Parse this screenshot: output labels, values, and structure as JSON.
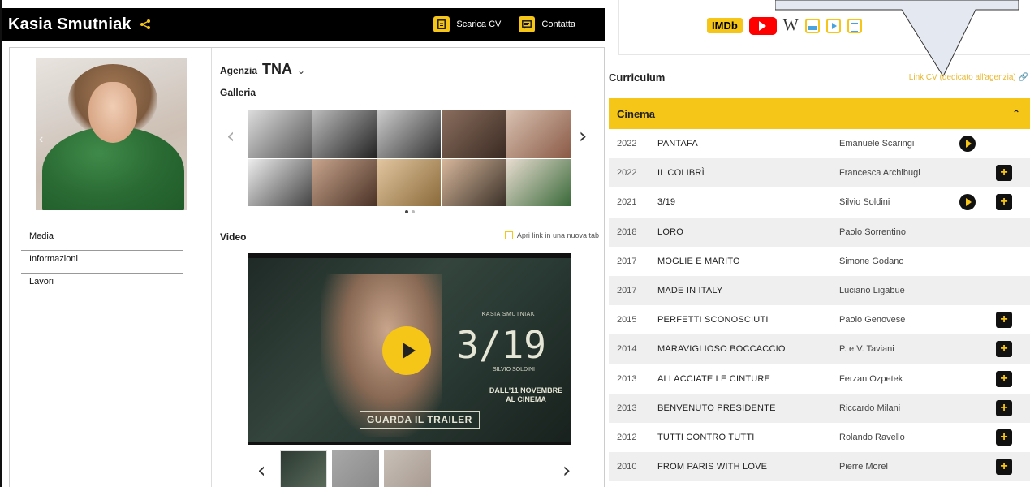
{
  "header": {
    "name": "Kasia Smutniak",
    "download_cv": "Scarica CV",
    "contact": "Contatta"
  },
  "side_menu": [
    {
      "label": "Media"
    },
    {
      "label": "Informazioni"
    },
    {
      "label": "Lavori"
    }
  ],
  "agency": {
    "label": "Agenzia",
    "value": "TNA"
  },
  "gallery": {
    "title": "Galleria",
    "photo_count": 10,
    "page_count": 2,
    "active_page": 1
  },
  "video": {
    "title": "Video",
    "open_new_tab": "Apri link in una nuova tab",
    "poster": {
      "name": "KASIA SMUTNIAK",
      "title": "3/19",
      "director": "SILVIO SOLDINI",
      "release": "DALL'11 NOVEMBRE AL CINEMA",
      "cta": "GUARDA IL TRAILER"
    },
    "thumb_count": 3
  },
  "links": {
    "imdb": "IMDb",
    "wiki": "W",
    "icons": [
      "imdb-icon",
      "youtube-icon",
      "wikipedia-icon",
      "image-icon",
      "video-icon",
      "news-icon"
    ]
  },
  "curriculum": {
    "title": "Curriculum",
    "agency_link": "Link CV (dedicato all'agenzia)",
    "section": "Cinema",
    "films": [
      {
        "year": "2022",
        "title": "PANTAFA",
        "director": "Emanuele Scaringi",
        "play": true,
        "plus": false
      },
      {
        "year": "2022",
        "title": "IL COLIBRÌ",
        "director": "Francesca Archibugi",
        "play": false,
        "plus": true
      },
      {
        "year": "2021",
        "title": "3/19",
        "director": "Silvio Soldini",
        "play": true,
        "plus": true
      },
      {
        "year": "2018",
        "title": "LORO",
        "director": "Paolo Sorrentino",
        "play": false,
        "plus": false
      },
      {
        "year": "2017",
        "title": "MOGLIE E MARITO",
        "director": "Simone Godano",
        "play": false,
        "plus": false
      },
      {
        "year": "2017",
        "title": "MADE IN ITALY",
        "director": "Luciano Ligabue",
        "play": false,
        "plus": false
      },
      {
        "year": "2015",
        "title": "PERFETTI SCONOSCIUTI",
        "director": "Paolo Genovese",
        "play": false,
        "plus": true
      },
      {
        "year": "2014",
        "title": "MARAVIGLIOSO BOCCACCIO",
        "director": "P. e V. Taviani",
        "play": false,
        "plus": true
      },
      {
        "year": "2013",
        "title": "ALLACCIATE LE CINTURE",
        "director": "Ferzan Ozpetek",
        "play": false,
        "plus": true
      },
      {
        "year": "2013",
        "title": "BENVENUTO PRESIDENTE",
        "director": "Riccardo Milani",
        "play": false,
        "plus": true
      },
      {
        "year": "2012",
        "title": "TUTTI CONTRO TUTTI",
        "director": "Rolando Ravello",
        "play": false,
        "plus": true
      },
      {
        "year": "2010",
        "title": "FROM PARIS WITH LOVE",
        "director": "Pierre Morel",
        "play": false,
        "plus": true
      }
    ]
  },
  "colors": {
    "accent": "#f5c518",
    "topbar": "#000000",
    "row_alt": "#efefef"
  }
}
